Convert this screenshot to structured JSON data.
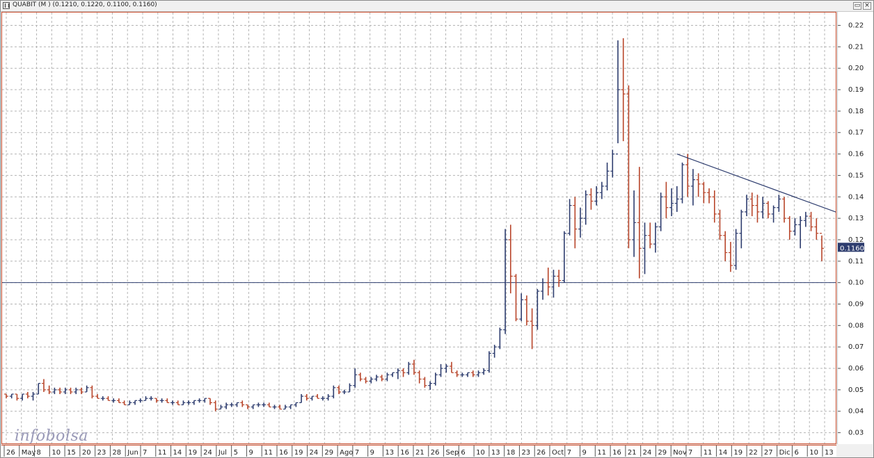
{
  "window": {
    "title": "QUABIT (M ) (0.1210, 0.1220, 0.1100, 0.1160)",
    "buttons": {
      "restore": "▭",
      "close": "×"
    }
  },
  "logo": {
    "part1": "info",
    "part2": "bolsa"
  },
  "colors": {
    "up": "#2d3c6e",
    "down": "#b8452a",
    "grid": "#b4b4b4",
    "support": "#2d3c6e",
    "trend": "#2d3c6e",
    "border": "#c84a2a"
  },
  "chart_data": {
    "type": "ohlc",
    "ylim": [
      0.025,
      0.226
    ],
    "yticks": [
      "0.03",
      "0.04",
      "0.05",
      "0.06",
      "0.07",
      "0.08",
      "0.09",
      "0.10",
      "0.11",
      "0.12",
      "0.13",
      "0.14",
      "0.15",
      "0.16",
      "0.17",
      "0.18",
      "0.19",
      "0.20",
      "0.21",
      "0.22"
    ],
    "xtick_labels": [
      "26",
      "May",
      "8",
      "10",
      "15",
      "20",
      "23",
      "28",
      "Jun",
      "7",
      "11",
      "14",
      "19",
      "24",
      "Jul",
      "5",
      "9",
      "11",
      "16",
      "19",
      "24",
      "29",
      "Ago",
      "7",
      "9",
      "13",
      "16",
      "21",
      "26",
      "Sep",
      "6",
      "10",
      "13",
      "18",
      "23",
      "26",
      "Oct",
      "7",
      "9",
      "11",
      "16",
      "21",
      "24",
      "29",
      "Nov",
      "7",
      "11",
      "14",
      "19",
      "22",
      "27",
      "Dic",
      "6",
      "10",
      "13"
    ],
    "last_price": "0.1160",
    "horizontal_line": 0.1,
    "trendline": {
      "start": {
        "index": 125,
        "value": 0.16
      },
      "end": {
        "index": 160,
        "value": 0.128
      }
    },
    "bars": [
      [
        0.048,
        0.048,
        0.046,
        0.047
      ],
      [
        0.047,
        0.048,
        0.046,
        0.048
      ],
      [
        0.048,
        0.048,
        0.045,
        0.046
      ],
      [
        0.046,
        0.048,
        0.045,
        0.048
      ],
      [
        0.048,
        0.049,
        0.046,
        0.047
      ],
      [
        0.047,
        0.049,
        0.045,
        0.048
      ],
      [
        0.048,
        0.053,
        0.048,
        0.053
      ],
      [
        0.053,
        0.055,
        0.049,
        0.05
      ],
      [
        0.05,
        0.052,
        0.048,
        0.049
      ],
      [
        0.049,
        0.051,
        0.048,
        0.05
      ],
      [
        0.05,
        0.051,
        0.048,
        0.049
      ],
      [
        0.049,
        0.051,
        0.048,
        0.05
      ],
      [
        0.05,
        0.051,
        0.048,
        0.049
      ],
      [
        0.049,
        0.051,
        0.048,
        0.05
      ],
      [
        0.05,
        0.051,
        0.048,
        0.049
      ],
      [
        0.049,
        0.052,
        0.049,
        0.051
      ],
      [
        0.051,
        0.052,
        0.046,
        0.047
      ],
      [
        0.047,
        0.048,
        0.046,
        0.046
      ],
      [
        0.046,
        0.047,
        0.045,
        0.046
      ],
      [
        0.046,
        0.047,
        0.045,
        0.045
      ],
      [
        0.045,
        0.046,
        0.044,
        0.045
      ],
      [
        0.045,
        0.046,
        0.044,
        0.044
      ],
      [
        0.044,
        0.045,
        0.043,
        0.043
      ],
      [
        0.043,
        0.045,
        0.043,
        0.044
      ],
      [
        0.044,
        0.045,
        0.043,
        0.045
      ],
      [
        0.045,
        0.046,
        0.044,
        0.045
      ],
      [
        0.045,
        0.047,
        0.045,
        0.046
      ],
      [
        0.046,
        0.047,
        0.045,
        0.046
      ],
      [
        0.046,
        0.046,
        0.044,
        0.045
      ],
      [
        0.045,
        0.046,
        0.044,
        0.045
      ],
      [
        0.045,
        0.046,
        0.044,
        0.044
      ],
      [
        0.044,
        0.045,
        0.043,
        0.044
      ],
      [
        0.044,
        0.045,
        0.043,
        0.043
      ],
      [
        0.043,
        0.045,
        0.043,
        0.044
      ],
      [
        0.044,
        0.045,
        0.043,
        0.044
      ],
      [
        0.044,
        0.045,
        0.043,
        0.045
      ],
      [
        0.045,
        0.046,
        0.044,
        0.045
      ],
      [
        0.045,
        0.046,
        0.044,
        0.046
      ],
      [
        0.046,
        0.046,
        0.043,
        0.044
      ],
      [
        0.044,
        0.045,
        0.04,
        0.041
      ],
      [
        0.041,
        0.043,
        0.041,
        0.042
      ],
      [
        0.042,
        0.044,
        0.041,
        0.043
      ],
      [
        0.043,
        0.044,
        0.042,
        0.043
      ],
      [
        0.043,
        0.044,
        0.042,
        0.044
      ],
      [
        0.044,
        0.045,
        0.042,
        0.043
      ],
      [
        0.043,
        0.043,
        0.041,
        0.042
      ],
      [
        0.042,
        0.043,
        0.041,
        0.043
      ],
      [
        0.043,
        0.044,
        0.042,
        0.043
      ],
      [
        0.043,
        0.044,
        0.042,
        0.043
      ],
      [
        0.043,
        0.044,
        0.042,
        0.042
      ],
      [
        0.042,
        0.043,
        0.041,
        0.042
      ],
      [
        0.042,
        0.043,
        0.041,
        0.041
      ],
      [
        0.041,
        0.043,
        0.041,
        0.042
      ],
      [
        0.042,
        0.043,
        0.041,
        0.043
      ],
      [
        0.043,
        0.044,
        0.042,
        0.044
      ],
      [
        0.044,
        0.048,
        0.044,
        0.047
      ],
      [
        0.047,
        0.048,
        0.045,
        0.046
      ],
      [
        0.046,
        0.047,
        0.045,
        0.047
      ],
      [
        0.047,
        0.048,
        0.046,
        0.046
      ],
      [
        0.046,
        0.047,
        0.045,
        0.046
      ],
      [
        0.046,
        0.048,
        0.045,
        0.047
      ],
      [
        0.047,
        0.052,
        0.046,
        0.051
      ],
      [
        0.051,
        0.052,
        0.048,
        0.049
      ],
      [
        0.049,
        0.05,
        0.048,
        0.049
      ],
      [
        0.049,
        0.053,
        0.049,
        0.052
      ],
      [
        0.052,
        0.06,
        0.051,
        0.057
      ],
      [
        0.057,
        0.058,
        0.054,
        0.055
      ],
      [
        0.055,
        0.056,
        0.053,
        0.054
      ],
      [
        0.054,
        0.056,
        0.053,
        0.055
      ],
      [
        0.055,
        0.057,
        0.054,
        0.056
      ],
      [
        0.056,
        0.057,
        0.054,
        0.055
      ],
      [
        0.055,
        0.058,
        0.054,
        0.057
      ],
      [
        0.057,
        0.058,
        0.056,
        0.058
      ],
      [
        0.058,
        0.06,
        0.055,
        0.059
      ],
      [
        0.059,
        0.06,
        0.056,
        0.058
      ],
      [
        0.058,
        0.063,
        0.057,
        0.062
      ],
      [
        0.062,
        0.064,
        0.057,
        0.058
      ],
      [
        0.058,
        0.059,
        0.053,
        0.055
      ],
      [
        0.055,
        0.056,
        0.051,
        0.052
      ],
      [
        0.052,
        0.054,
        0.05,
        0.053
      ],
      [
        0.053,
        0.058,
        0.052,
        0.057
      ],
      [
        0.057,
        0.062,
        0.056,
        0.06
      ],
      [
        0.06,
        0.062,
        0.058,
        0.061
      ],
      [
        0.061,
        0.063,
        0.058,
        0.058
      ],
      [
        0.058,
        0.059,
        0.056,
        0.057
      ],
      [
        0.057,
        0.058,
        0.056,
        0.057
      ],
      [
        0.057,
        0.058,
        0.056,
        0.058
      ],
      [
        0.058,
        0.059,
        0.056,
        0.057
      ],
      [
        0.057,
        0.059,
        0.056,
        0.058
      ],
      [
        0.058,
        0.06,
        0.057,
        0.059
      ],
      [
        0.059,
        0.068,
        0.058,
        0.067
      ],
      [
        0.067,
        0.071,
        0.065,
        0.07
      ],
      [
        0.07,
        0.079,
        0.069,
        0.078
      ],
      [
        0.078,
        0.125,
        0.076,
        0.12
      ],
      [
        0.12,
        0.127,
        0.095,
        0.103
      ],
      [
        0.103,
        0.104,
        0.082,
        0.083
      ],
      [
        0.083,
        0.095,
        0.082,
        0.092
      ],
      [
        0.092,
        0.094,
        0.08,
        0.082
      ],
      [
        0.082,
        0.088,
        0.069,
        0.08
      ],
      [
        0.08,
        0.097,
        0.078,
        0.096
      ],
      [
        0.096,
        0.102,
        0.092,
        0.1
      ],
      [
        0.1,
        0.107,
        0.094,
        0.098
      ],
      [
        0.098,
        0.106,
        0.093,
        0.103
      ],
      [
        0.103,
        0.106,
        0.098,
        0.101
      ],
      [
        0.101,
        0.124,
        0.1,
        0.123
      ],
      [
        0.123,
        0.139,
        0.122,
        0.136
      ],
      [
        0.136,
        0.14,
        0.116,
        0.125
      ],
      [
        0.125,
        0.135,
        0.121,
        0.13
      ],
      [
        0.13,
        0.143,
        0.127,
        0.141
      ],
      [
        0.141,
        0.144,
        0.134,
        0.138
      ],
      [
        0.138,
        0.145,
        0.136,
        0.142
      ],
      [
        0.142,
        0.147,
        0.139,
        0.145
      ],
      [
        0.145,
        0.156,
        0.143,
        0.152
      ],
      [
        0.152,
        0.162,
        0.149,
        0.16
      ],
      [
        0.16,
        0.213,
        0.165,
        0.19
      ],
      [
        0.19,
        0.214,
        0.166,
        0.188
      ],
      [
        0.188,
        0.192,
        0.116,
        0.12
      ],
      [
        0.12,
        0.143,
        0.112,
        0.128
      ],
      [
        0.128,
        0.154,
        0.102,
        0.116
      ],
      [
        0.116,
        0.128,
        0.104,
        0.122
      ],
      [
        0.122,
        0.128,
        0.116,
        0.118
      ],
      [
        0.118,
        0.128,
        0.114,
        0.126
      ],
      [
        0.126,
        0.142,
        0.124,
        0.14
      ],
      [
        0.14,
        0.147,
        0.13,
        0.135
      ],
      [
        0.135,
        0.144,
        0.131,
        0.137
      ],
      [
        0.137,
        0.145,
        0.133,
        0.139
      ],
      [
        0.139,
        0.156,
        0.137,
        0.155
      ],
      [
        0.155,
        0.16,
        0.14,
        0.145
      ],
      [
        0.145,
        0.153,
        0.136,
        0.148
      ],
      [
        0.148,
        0.151,
        0.14,
        0.146
      ],
      [
        0.146,
        0.147,
        0.137,
        0.142
      ],
      [
        0.142,
        0.144,
        0.137,
        0.14
      ],
      [
        0.14,
        0.143,
        0.128,
        0.132
      ],
      [
        0.132,
        0.134,
        0.12,
        0.122
      ],
      [
        0.122,
        0.124,
        0.11,
        0.114
      ],
      [
        0.114,
        0.119,
        0.105,
        0.108
      ],
      [
        0.108,
        0.125,
        0.106,
        0.123
      ],
      [
        0.123,
        0.134,
        0.116,
        0.133
      ],
      [
        0.133,
        0.141,
        0.131,
        0.139
      ],
      [
        0.139,
        0.142,
        0.131,
        0.136
      ],
      [
        0.136,
        0.141,
        0.128,
        0.133
      ],
      [
        0.133,
        0.14,
        0.13,
        0.137
      ],
      [
        0.137,
        0.138,
        0.13,
        0.132
      ],
      [
        0.132,
        0.136,
        0.128,
        0.135
      ],
      [
        0.135,
        0.141,
        0.133,
        0.139
      ],
      [
        0.139,
        0.14,
        0.128,
        0.13
      ],
      [
        0.13,
        0.131,
        0.12,
        0.124
      ],
      [
        0.124,
        0.13,
        0.122,
        0.127
      ],
      [
        0.127,
        0.131,
        0.116,
        0.129
      ],
      [
        0.129,
        0.133,
        0.126,
        0.131
      ],
      [
        0.131,
        0.133,
        0.124,
        0.126
      ],
      [
        0.126,
        0.13,
        0.12,
        0.123
      ],
      [
        0.123,
        0.122,
        0.11,
        0.116
      ]
    ]
  }
}
